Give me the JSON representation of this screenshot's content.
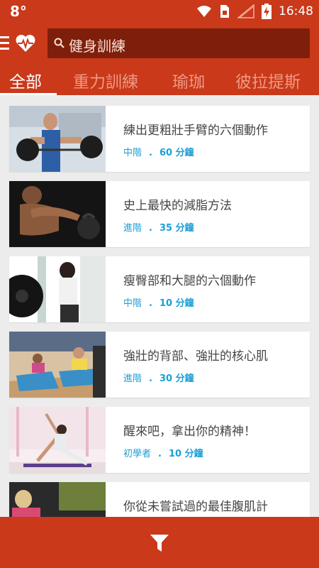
{
  "status_bar": {
    "carrier": "8°",
    "time": "16:48"
  },
  "search": {
    "text": "健身訓練"
  },
  "tabs": [
    {
      "label": "全部",
      "active": true
    },
    {
      "label": "重力訓練",
      "active": false
    },
    {
      "label": "瑜珈",
      "active": false
    },
    {
      "label": "彼拉提斯",
      "active": false
    }
  ],
  "workouts": [
    {
      "title": "練出更粗壯手臂的六個動作",
      "level": "中階",
      "duration": "60 分鐘",
      "image": "barbell-curl-photo"
    },
    {
      "title": "史上最快的減脂方法",
      "level": "進階",
      "duration": "35 分鐘",
      "image": "kettlebell-swing-photo"
    },
    {
      "title": "瘦臀部和大腿的六個動作",
      "level": "中階",
      "duration": "10 分鐘",
      "image": "weight-plate-photo"
    },
    {
      "title": "強壯的背部、強壯的核心肌",
      "level": "進階",
      "duration": "30 分鐘",
      "image": "group-plank-photo"
    },
    {
      "title": "醒來吧，拿出你的精神！",
      "level": "初學者",
      "duration": "10 分鐘",
      "image": "yoga-stretch-photo"
    },
    {
      "title": "你從未嘗試過的最佳腹肌計",
      "level": "",
      "duration": "",
      "image": "ab-workout-photo"
    }
  ],
  "colors": {
    "primary": "#c9391a",
    "search_bg": "#7e1f0c",
    "accent_text": "#1b9fd6",
    "inactive_tab": "#ef9a83"
  }
}
